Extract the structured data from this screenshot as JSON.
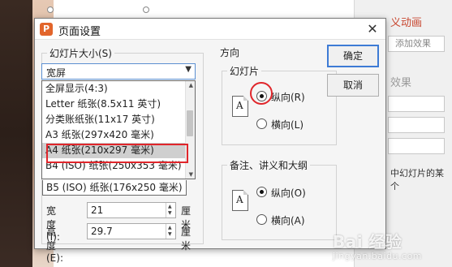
{
  "background": {
    "panel_title": "义动画",
    "effect_button": "添加效果",
    "effect_label": "效果",
    "note_text": "中幻灯片的某个",
    "accent_color": "#c8462f"
  },
  "watermark": {
    "text": "Bai 经验",
    "sub": "jingyan.baidu.com"
  },
  "dialog": {
    "title": "页面设置",
    "app_icon": "P",
    "close_glyph": "✕",
    "slide_size": {
      "label": "幻灯片大小(S)",
      "selected_value": "宽屏",
      "options": [
        "全屏显示(4:3)",
        "Letter 纸张(8.5x11 英寸)",
        "分类账纸张(11x17 英寸)",
        "A3 纸张(297x420 毫米)",
        "A4 纸张(210x297 毫米)",
        "B4 (ISO) 纸张(250x353 毫米)",
        "B5 (ISO) 纸张(176x250 毫米)"
      ],
      "highlighted_option": "A4 纸张(210x297 毫米)"
    },
    "width": {
      "label": "宽度(I):",
      "value": "21",
      "unit": "厘米"
    },
    "height": {
      "label": "高度(E):",
      "value": "29.7",
      "unit": "厘米"
    },
    "orientation": {
      "title": "方向",
      "slides": {
        "label": "幻灯片",
        "portrait": "纵向(R)",
        "landscape": "横向(L)",
        "selected": "portrait"
      },
      "notes": {
        "label": "备注、讲义和大纲",
        "portrait": "纵向(O)",
        "landscape": "横向(A)",
        "selected": "portrait"
      },
      "page_letter": "A"
    },
    "buttons": {
      "ok": "确定",
      "cancel": "取消"
    },
    "highlight_color": "#e0262b"
  }
}
